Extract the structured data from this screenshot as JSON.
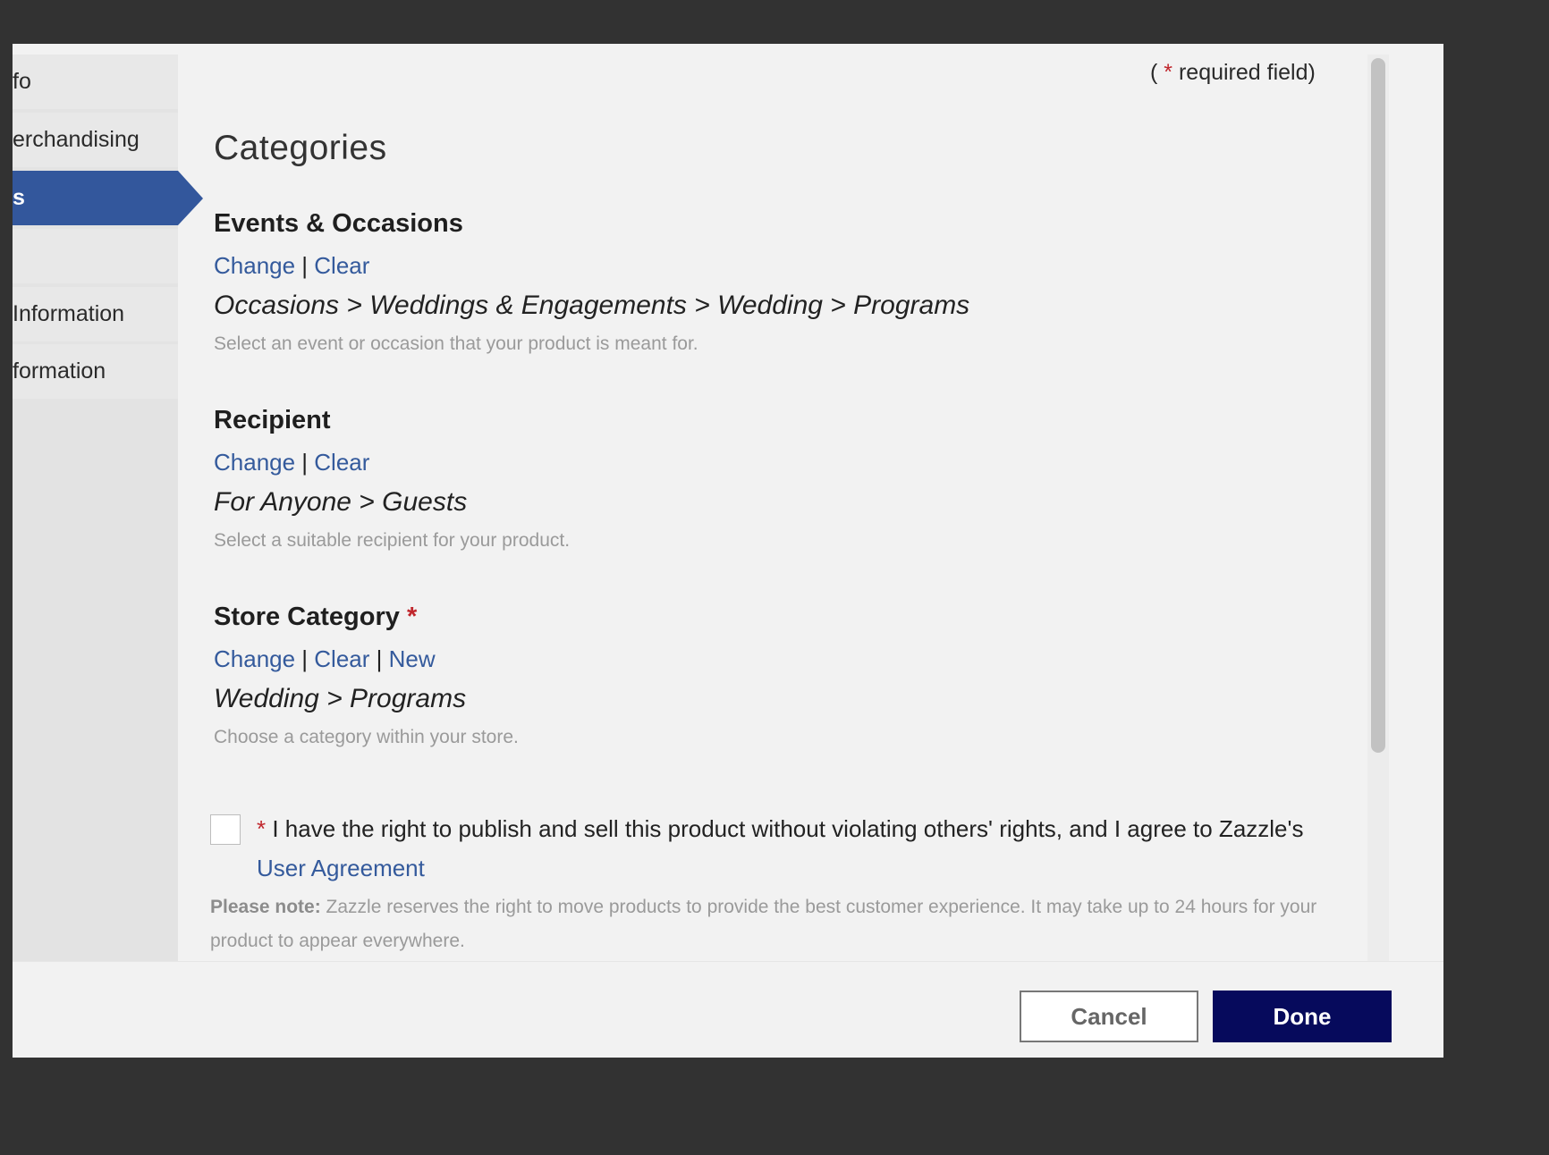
{
  "required_note": {
    "open": "( ",
    "star": "*",
    "text": " required field)"
  },
  "sidebar": {
    "items": [
      {
        "label": "fo"
      },
      {
        "label": "erchandising"
      },
      {
        "label": "s"
      },
      {
        "label": ""
      },
      {
        "label": " Information"
      },
      {
        "label": "formation"
      }
    ]
  },
  "main": {
    "title": "Categories",
    "sections": [
      {
        "heading": "Events & Occasions",
        "change": "Change",
        "sep": " | ",
        "clear": "Clear",
        "path": "Occasions > Weddings & Engagements > Wedding > Programs",
        "hint": "Select an event or occasion that your product is meant for."
      },
      {
        "heading": "Recipient",
        "change": "Change",
        "sep": " | ",
        "clear": "Clear",
        "path": "For Anyone > Guests",
        "hint": "Select a suitable recipient for your product."
      },
      {
        "heading": "Store Category",
        "star": "*",
        "change": "Change",
        "sep": " | ",
        "clear": "Clear",
        "sep2": " | ",
        "new": "New",
        "path": "Wedding > Programs",
        "hint": "Choose a category within your store."
      }
    ],
    "agreement": {
      "star": "*",
      "text": " I have the right to publish and sell this product without violating others' rights, and I agree to Zazzle's ",
      "link": "User Agreement"
    },
    "note": {
      "label": "Please note:",
      "text": " Zazzle reserves the right to move products to provide the best customer experience. It may take up to 24 hours for your product to appear everywhere."
    }
  },
  "footer": {
    "cancel": "Cancel",
    "done": "Done"
  },
  "colors": {
    "accent": "#33579c",
    "link": "#345a9c",
    "primary_button": "#060a5c",
    "required": "#c0262c"
  }
}
